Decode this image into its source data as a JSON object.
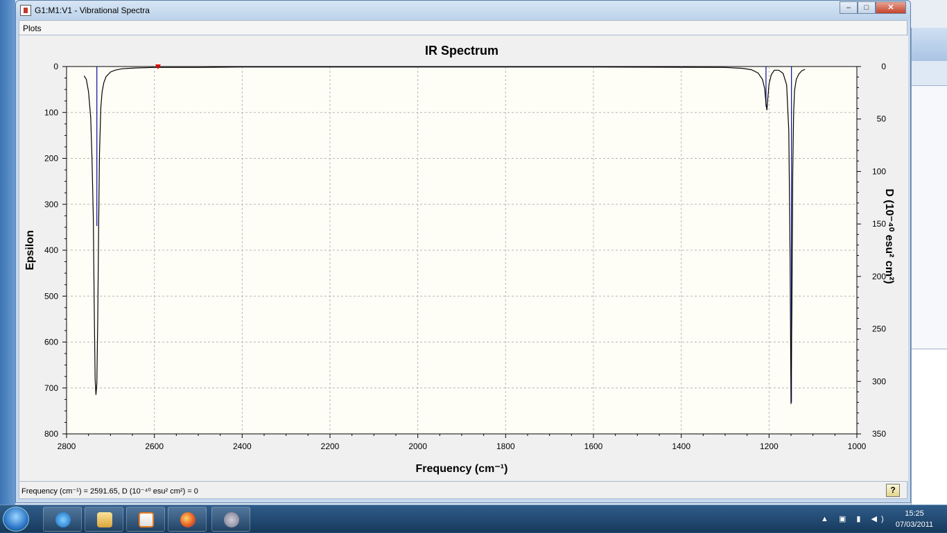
{
  "window": {
    "title": "G1:M1:V1 - Vibrational Spectra",
    "controls": {
      "minimize": "–",
      "maximize": "□",
      "close": "✕"
    }
  },
  "menu": {
    "plots": "Plots"
  },
  "status": {
    "text": "Frequency (cm⁻¹) = 2591.65, D (10⁻⁴⁰ esu² cm²) = 0",
    "help": "?"
  },
  "taskbar": {
    "time": "15:25",
    "date": "07/03/2011"
  },
  "chart_data": {
    "type": "line",
    "title": "IR Spectrum",
    "xlabel": "Frequency (cm⁻¹)",
    "ylabel": "Epsilon",
    "y2label": "D (10⁻⁴⁰ esu² cm²)",
    "xlim": [
      2800,
      1000
    ],
    "ylim": [
      0,
      800
    ],
    "y2lim": [
      0,
      350
    ],
    "x_ticks": [
      2800,
      2600,
      2400,
      2200,
      2000,
      1800,
      1600,
      1400,
      1200,
      1000
    ],
    "y_ticks": [
      0,
      100,
      200,
      300,
      400,
      500,
      600,
      700,
      800
    ],
    "y2_ticks": [
      0,
      50,
      100,
      150,
      200,
      250,
      300,
      350
    ],
    "x_tick_labels": [
      "2800",
      "2600",
      "2400",
      "2200",
      "2000",
      "1800",
      "1600",
      "1400",
      "1200",
      "1000"
    ],
    "y_tick_labels": [
      "0",
      "100",
      "200",
      "300",
      "400",
      "500",
      "600",
      "700",
      "800"
    ],
    "y2_tick_labels": [
      "0",
      "50",
      "100",
      "150",
      "200",
      "250",
      "300",
      "350"
    ],
    "y_inverted": true,
    "grid": true,
    "spectrum": {
      "x": [
        2760,
        2755,
        2750,
        2745,
        2742,
        2739,
        2737,
        2735,
        2733,
        2731,
        2729,
        2727,
        2725,
        2722,
        2719,
        2715,
        2710,
        2700,
        2690,
        2675,
        2660,
        2640,
        2600,
        2500,
        2400,
        2000,
        1600,
        1300,
        1260,
        1240,
        1225,
        1215,
        1210,
        1207,
        1205,
        1203,
        1200,
        1195,
        1188,
        1178,
        1168,
        1160,
        1155,
        1152,
        1150,
        1148,
        1146,
        1144,
        1142,
        1138,
        1132,
        1125,
        1118
      ],
      "y": [
        20,
        28,
        55,
        110,
        200,
        330,
        520,
        680,
        715,
        690,
        550,
        360,
        190,
        90,
        55,
        35,
        22,
        12,
        8,
        5,
        4,
        3,
        2,
        2,
        1,
        1,
        1,
        2,
        4,
        7,
        14,
        28,
        48,
        80,
        95,
        72,
        38,
        18,
        8,
        8,
        15,
        40,
        140,
        420,
        735,
        520,
        230,
        100,
        52,
        28,
        16,
        9,
        6
      ]
    },
    "sticks": {
      "x": [
        2731,
        1207,
        1149
      ],
      "d": [
        152,
        38,
        320
      ]
    },
    "cursor": {
      "x": 2591.65,
      "d": 0
    },
    "colors": {
      "curve": "#000000",
      "sticks": "#1a1aa6",
      "cursor": "#e00000",
      "plot_bg": "#fffef6",
      "grid": "#b5b5b5"
    }
  }
}
